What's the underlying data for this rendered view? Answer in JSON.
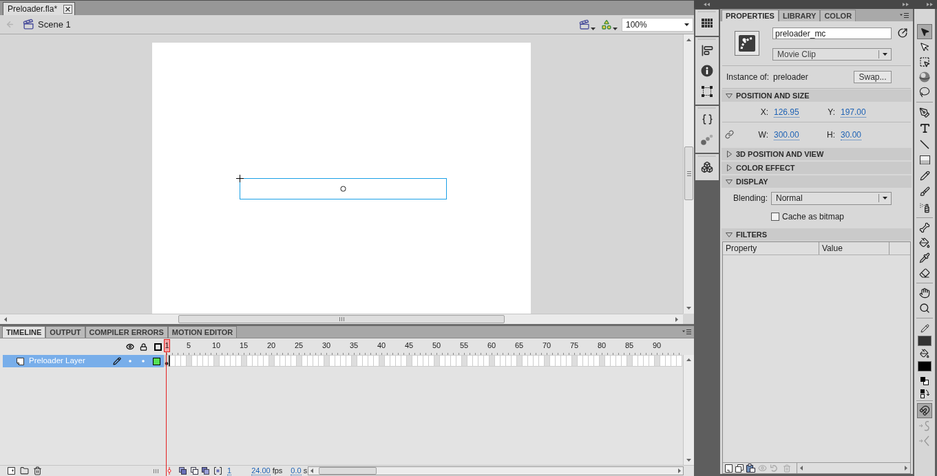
{
  "document_tabs": [
    {
      "label": "Preloader.fla*",
      "selected": true
    }
  ],
  "edit_bar": {
    "scene": "Scene 1",
    "zoom": "100%"
  },
  "timeline": {
    "tabs": [
      {
        "label": "TIMELINE",
        "selected": true
      },
      {
        "label": "OUTPUT",
        "selected": false
      },
      {
        "label": "COMPILER ERRORS",
        "selected": false
      },
      {
        "label": "MOTION EDITOR",
        "selected": false
      }
    ],
    "frame_ruler": [
      {
        "label": "1",
        "selected": true
      },
      {
        "label": "5",
        "selected": false
      },
      {
        "label": "10",
        "selected": false
      },
      {
        "label": "15",
        "selected": false
      },
      {
        "label": "20",
        "selected": false
      },
      {
        "label": "25",
        "selected": false
      },
      {
        "label": "30",
        "selected": false
      },
      {
        "label": "35",
        "selected": false
      },
      {
        "label": "40",
        "selected": false
      },
      {
        "label": "45",
        "selected": false
      },
      {
        "label": "50",
        "selected": false
      },
      {
        "label": "55",
        "selected": false
      },
      {
        "label": "60",
        "selected": false
      },
      {
        "label": "65",
        "selected": false
      },
      {
        "label": "70",
        "selected": false
      },
      {
        "label": "75",
        "selected": false
      },
      {
        "label": "80",
        "selected": false
      },
      {
        "label": "85",
        "selected": false
      },
      {
        "label": "90",
        "selected": false
      }
    ],
    "layers": [
      {
        "name": "Preloader Layer",
        "selected": true,
        "visible": true,
        "locked": false,
        "color": "#55e155"
      }
    ],
    "status": {
      "current_frame": "1",
      "frame_rate": "24.00",
      "frame_rate_unit": "fps",
      "elapsed": "0.0",
      "elapsed_unit": "s"
    }
  },
  "panel_tabs": [
    {
      "label": "PROPERTIES",
      "selected": true
    },
    {
      "label": "LIBRARY",
      "selected": false
    },
    {
      "label": "COLOR",
      "selected": false
    }
  ],
  "properties": {
    "instance_name": "preloader_mc",
    "symbol_type": "Movie Clip",
    "instance_of_label": "Instance of:",
    "instance_of": "preloader",
    "swap_button": "Swap...",
    "sections": [
      {
        "kind": "position",
        "title": "POSITION AND SIZE",
        "expanded": true,
        "fields": [
          {
            "label": "X:",
            "value": "126.95"
          },
          {
            "label": "Y:",
            "value": "197.00"
          },
          {
            "label": "W:",
            "value": "300.00"
          },
          {
            "label": "H:",
            "value": "30.00"
          }
        ]
      },
      {
        "kind": "plain",
        "title": "3D POSITION AND VIEW",
        "expanded": false
      },
      {
        "kind": "plain",
        "title": "COLOR EFFECT",
        "expanded": false
      },
      {
        "kind": "display",
        "title": "DISPLAY",
        "expanded": true,
        "blending_label": "Blending:",
        "blending": "Normal",
        "cache_label": "Cache as bitmap",
        "cache_checked": false
      },
      {
        "kind": "filters",
        "title": "FILTERS",
        "expanded": true,
        "columns": [
          "Property",
          "Value"
        ]
      }
    ]
  },
  "tool_groups": [
    [
      {
        "kind": "selection",
        "selected": true
      },
      {
        "kind": "subselection",
        "selected": false
      },
      {
        "kind": "free_transform",
        "selected": false
      },
      {
        "kind": "rotation_3d",
        "selected": false
      },
      {
        "kind": "lasso",
        "selected": false
      }
    ],
    [
      {
        "kind": "pen",
        "selected": false
      },
      {
        "kind": "text",
        "selected": false
      },
      {
        "kind": "line",
        "selected": false
      },
      {
        "kind": "rectangle",
        "selected": false
      },
      {
        "kind": "pencil",
        "selected": false
      },
      {
        "kind": "brush",
        "selected": false
      },
      {
        "kind": "deco",
        "selected": false
      }
    ],
    [
      {
        "kind": "bone",
        "selected": false
      },
      {
        "kind": "bucket",
        "selected": false
      },
      {
        "kind": "eyedropper",
        "selected": false
      },
      {
        "kind": "eraser",
        "selected": false
      }
    ],
    [
      {
        "kind": "hand",
        "selected": false
      },
      {
        "kind": "zoom",
        "selected": false
      }
    ]
  ],
  "colors": [
    {
      "kind": "stroke",
      "color": "#333333"
    },
    {
      "kind": "fill",
      "color": "#000000"
    }
  ],
  "options": [
    {
      "kind": "snap",
      "on": true,
      "disabled": false
    },
    {
      "kind": "smooth",
      "on": false,
      "disabled": true
    },
    {
      "kind": "straighten",
      "on": false,
      "disabled": true
    }
  ]
}
